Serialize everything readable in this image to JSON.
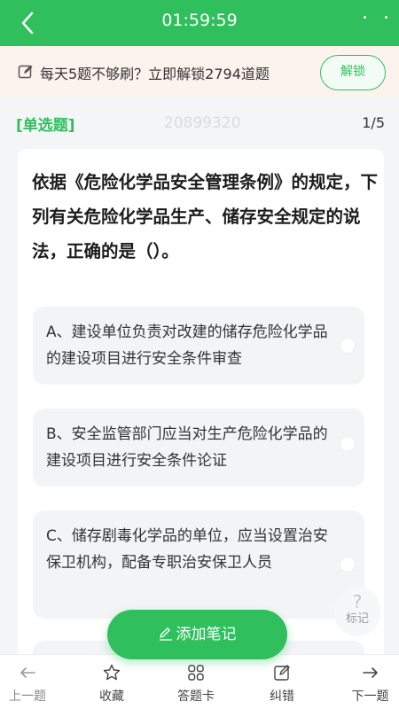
{
  "header": {
    "timer": "01:59:59"
  },
  "banner": {
    "text": "每天5题不够刷？立即解锁2794道题",
    "unlock_label": "解锁"
  },
  "question": {
    "type": "[单选题]",
    "id": "20899320",
    "progress": "1/5",
    "stem": "依据《危险化学品安全管理条例》的规定，下列有关危险化学品生产、储存安全规定的说法，正确的是（）。",
    "options": [
      {
        "text": "A、建设单位负责对改建的储存危险化学品的建设项目进行安全条件审查"
      },
      {
        "text": "B、安全监管部门应当对生产危险化学品的建设项目进行安全条件论证"
      },
      {
        "text": "C、储存剧毒化学品的单位，应当设置治安保卫机构，配备专职治安保卫人员"
      }
    ]
  },
  "mark": {
    "label": "标记"
  },
  "add_note": {
    "label": "添加笔记"
  },
  "bottom_nav": {
    "prev": "上一题",
    "favorite": "收藏",
    "answer_sheet": "答题卡",
    "correct": "纠错",
    "next": "下一题"
  },
  "colors": {
    "accent": "#2fbf5c",
    "banner_bg": "#fdf3ee"
  }
}
